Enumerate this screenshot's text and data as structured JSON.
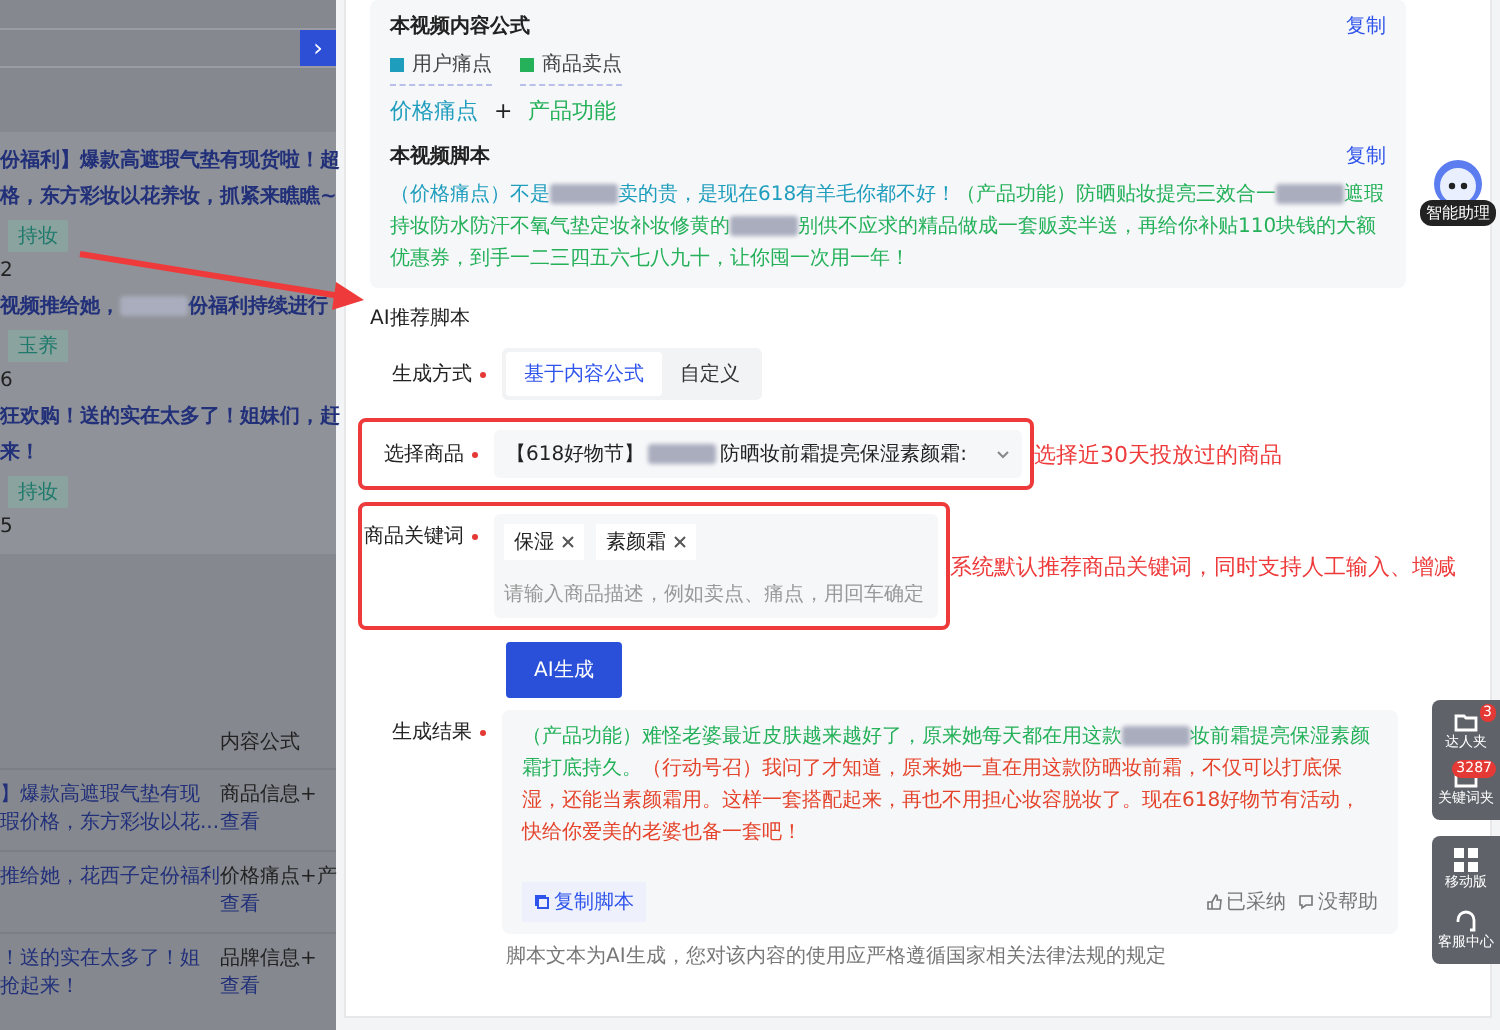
{
  "left_panel": {
    "expand_button": "›",
    "cards": [
      {
        "lines": [
          [
            {
              "kind": "text",
              "text": "份福利】爆款高遮瑕气垫有现货啦！超"
            }
          ],
          [
            {
              "kind": "text",
              "text": "格，东方彩妆以花养妆，抓紧来瞧瞧~"
            }
          ]
        ],
        "tag": "持妆",
        "count": "2"
      },
      {
        "lines": [
          [
            {
              "kind": "text",
              "text": "视频推给她，"
            },
            {
              "kind": "redacted"
            },
            {
              "kind": "text",
              "text": "份福利持续进行"
            }
          ]
        ],
        "tag": "玉养",
        "count": "6"
      },
      {
        "lines": [
          [
            {
              "kind": "text",
              "text": "狂欢购！送的实在太多了！姐妹们，赶"
            }
          ],
          [
            {
              "kind": "text",
              "text": "来！"
            }
          ]
        ],
        "tag": "持妆",
        "count": "5"
      }
    ],
    "table": {
      "column_2_header": "内容公式",
      "rows": [
        {
          "title": [
            "】爆款高遮瑕气垫有现",
            "瑕价格，东方彩妆以花..."
          ],
          "formula": "商品信息+",
          "link": "查看"
        },
        {
          "title": [
            "推给她，花西子定份福利"
          ],
          "formula": "价格痛点+产",
          "link": "查看"
        },
        {
          "title": [
            "！送的实在太多了！姐",
            "抢起来！"
          ],
          "formula": "品牌信息+",
          "link": "查看"
        }
      ]
    }
  },
  "formula_section": {
    "title": "本视频内容公式",
    "copy_link": "复制",
    "legend": [
      {
        "kind": "pain_point",
        "label": "用户痛点"
      },
      {
        "kind": "selling_point",
        "label": "商品卖点"
      }
    ],
    "formula": [
      {
        "kind": "pain_point",
        "label": "价格痛点"
      },
      {
        "kind": "selling_point",
        "label": "产品功能"
      }
    ],
    "joiner": "+"
  },
  "script_section": {
    "title": "本视频脚本",
    "copy_link": "复制",
    "segments": [
      {
        "kind": "pain_point",
        "text": "（价格痛点）不是"
      },
      {
        "kind": "redacted"
      },
      {
        "kind": "pain_point",
        "text": "卖的贵，是现在618有羊毛你都不好！"
      },
      {
        "kind": "selling_point",
        "text": "（产品功能）防晒贴妆提亮三效合一"
      },
      {
        "kind": "redacted"
      },
      {
        "kind": "selling_point",
        "text": "遮瑕持妆防水防汗不氧气垫定妆补妆修黄的"
      },
      {
        "kind": "redacted"
      },
      {
        "kind": "selling_point",
        "text": "别供不应求的精品做成一套贩卖半送，再给你补贴110块钱的大额优惠券，到手一二三四五六七八九十，让你囤一次用一年！"
      }
    ]
  },
  "ai_section": {
    "title": "AI推荐脚本",
    "mode": {
      "label": "生成方式",
      "required": true,
      "options": [
        {
          "label": "基于内容公式",
          "selected": true
        },
        {
          "label": "自定义",
          "selected": false
        }
      ]
    },
    "product": {
      "label": "选择商品",
      "required": true,
      "value_parts": [
        {
          "kind": "text",
          "text": "【618好物节】"
        },
        {
          "kind": "redacted"
        },
        {
          "kind": "text",
          "text": "防晒妆前霜提亮保湿素颜霜:"
        }
      ],
      "note": "选择近30天投放过的商品"
    },
    "keywords": {
      "label": "商品关键词",
      "required": true,
      "tags": [
        "保湿",
        "素颜霜"
      ],
      "placeholder": "请输入商品描述，例如卖点、痛点，用回车确定",
      "note": "系统默认推荐商品关键词，同时支持人工输入、增减"
    },
    "generate_button": "AI生成",
    "result": {
      "label": "生成结果",
      "required": true,
      "segments": [
        {
          "kind": "selling_point",
          "text": "（产品功能）难怪老婆最近皮肤越来越好了，原来她每天都在用这款"
        },
        {
          "kind": "redacted"
        },
        {
          "kind": "selling_point",
          "text": "妆前霜提亮保湿素颜霜打底持久。"
        },
        {
          "kind": "call_to_action",
          "text": "（行动号召）我问了才知道，原来她一直在用这款防晒妆前霜，不仅可以打底保湿，还能当素颜霜用。这样一套搭配起来，再也不用担心妆容脱妆了。现在618好物节有活动，快给你爱美的老婆也备一套吧！"
        }
      ],
      "copy_button": "复制脚本",
      "adopted": "已采纳",
      "unhelpful": "没帮助"
    },
    "disclaimer": "脚本文本为AI生成，您对该内容的使用应严格遵循国家相关法律法规的规定"
  },
  "assistant": {
    "label": "智能助理"
  },
  "toolbar_top": [
    {
      "kind": "folder",
      "label": "达人夹",
      "badge": "3"
    },
    {
      "kind": "box",
      "label": "关键词夹",
      "badge": "3287"
    }
  ],
  "toolbar_bottom": [
    {
      "kind": "grid",
      "label": "移动版"
    },
    {
      "kind": "headset",
      "label": "客服中心"
    }
  ]
}
